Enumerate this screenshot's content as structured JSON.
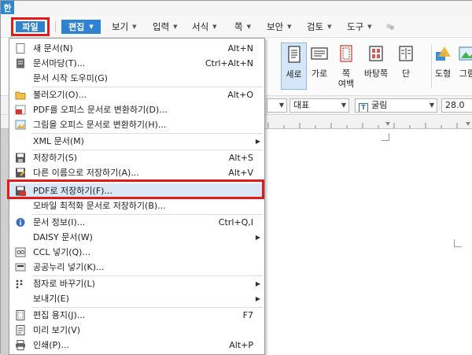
{
  "app": {
    "icon_glyph": "한"
  },
  "menubar": {
    "items": [
      {
        "label": "파일",
        "caret": false
      },
      {
        "label": "편집",
        "caret": true
      },
      {
        "label": "보기",
        "caret": true
      },
      {
        "label": "입력",
        "caret": true
      },
      {
        "label": "서식",
        "caret": true
      },
      {
        "label": "쪽",
        "caret": true
      },
      {
        "label": "보안",
        "caret": true
      },
      {
        "label": "검토",
        "caret": true
      },
      {
        "label": "도구",
        "caret": true
      }
    ]
  },
  "ribbon": {
    "buttons": [
      {
        "label": "세로",
        "sub": "",
        "active": true
      },
      {
        "label": "가로",
        "sub": "",
        "active": false
      },
      {
        "label": "쪽",
        "sub": "여백",
        "active": false
      },
      {
        "label": "바탕쪽",
        "sub": "",
        "active": false
      },
      {
        "label": "단",
        "sub": "",
        "active": false
      },
      {
        "label": "도형",
        "sub": "",
        "active": false
      },
      {
        "label": "그림",
        "sub": "",
        "active": false
      }
    ]
  },
  "formatbar": {
    "style_value": "대표",
    "font_value": "굴림",
    "size_value": "28.0"
  },
  "file_menu": {
    "items": [
      {
        "label": "새 문서(N)",
        "shortcut": "Alt+N",
        "icon": "new-document-icon",
        "arrow": false
      },
      {
        "label": "문서마당(T)...",
        "shortcut": "Ctrl+Alt+N",
        "icon": "template-icon",
        "arrow": false
      },
      {
        "label": "문서 시작 도우미(G)",
        "shortcut": "",
        "icon": "",
        "arrow": false
      },
      {
        "label": "불러오기(O)...",
        "shortcut": "Alt+O",
        "icon": "folder-open-icon",
        "arrow": false
      },
      {
        "label": "PDF를 오피스 문서로 변환하기(D)...",
        "shortcut": "",
        "icon": "pdf-convert-icon",
        "arrow": false
      },
      {
        "label": "그림을 오피스 문서로 변환하기(H)...",
        "shortcut": "",
        "icon": "image-convert-icon",
        "arrow": false
      },
      {
        "label": "XML 문서(M)",
        "shortcut": "",
        "icon": "",
        "arrow": true
      },
      {
        "label": "저장하기(S)",
        "shortcut": "Alt+S",
        "icon": "save-icon",
        "arrow": false
      },
      {
        "label": "다른 이름으로 저장하기(A)...",
        "shortcut": "Alt+V",
        "icon": "save-as-icon",
        "arrow": false
      },
      {
        "label": "PDF로 저장하기(F)...",
        "shortcut": "",
        "icon": "save-pdf-icon",
        "arrow": false,
        "highlighted": true
      },
      {
        "label": "모바일 최적화 문서로 저장하기(B)...",
        "shortcut": "",
        "icon": "",
        "arrow": false
      },
      {
        "label": "문서 정보(I)...",
        "shortcut": "Ctrl+Q,I",
        "icon": "info-icon",
        "arrow": false
      },
      {
        "label": "DAISY 문서(W)",
        "shortcut": "",
        "icon": "",
        "arrow": true
      },
      {
        "label": "CCL 넣기(Q)...",
        "shortcut": "",
        "icon": "ccl-icon",
        "arrow": false
      },
      {
        "label": "공공누리 넣기(K)...",
        "shortcut": "",
        "icon": "kogl-icon",
        "arrow": false
      },
      {
        "label": "점자로 바꾸기(L)",
        "shortcut": "",
        "icon": "braille-icon",
        "arrow": true
      },
      {
        "label": "보내기(E)",
        "shortcut": "",
        "icon": "",
        "arrow": true
      },
      {
        "label": "편집 용지(J)...",
        "shortcut": "F7",
        "icon": "page-setup-icon",
        "arrow": false
      },
      {
        "label": "미리 보기(V)",
        "shortcut": "",
        "icon": "preview-icon",
        "arrow": false
      },
      {
        "label": "인쇄(P)...",
        "shortcut": "Alt+P",
        "icon": "print-icon",
        "arrow": false
      }
    ]
  },
  "colors": {
    "accent": "#2f82cf",
    "highlight_border": "#e31a1a",
    "hover": "#d9e7f7"
  }
}
